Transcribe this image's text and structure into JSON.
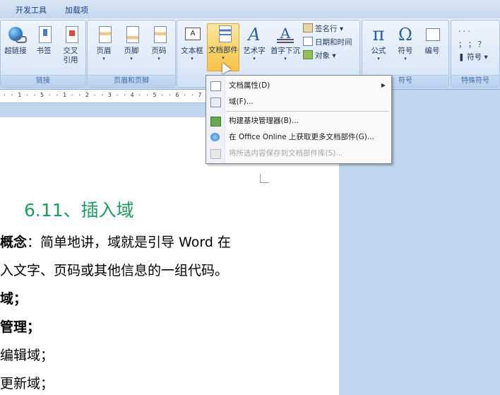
{
  "tabs": {
    "developer": "开发工具",
    "addins": "加载项"
  },
  "ribbon": {
    "links_group": {
      "label": "链接",
      "hyperlink": "超链接",
      "bookmark": "书签",
      "cross_ref_line1": "交叉",
      "cross_ref_line2": "引用"
    },
    "header_footer_group": {
      "label": "页眉和页脚",
      "header": "页眉",
      "footer": "页脚",
      "page_number": "页码"
    },
    "text_group": {
      "textbox": "文本框",
      "quick_parts": "文档部件",
      "wordart": "艺术字",
      "dropcap": "首字下沉",
      "signature_line": "签名行",
      "date_time": "日期和时间",
      "object": "对象"
    },
    "symbols_group": {
      "label": "符号",
      "equation": "公式",
      "symbol": "符号",
      "numbering": "编号"
    },
    "special_group": {
      "label": "特殊符号",
      "dots_row1": "·  ·  ·",
      "dots_row2": "；  ；  ？",
      "symbol_dropdown": "符号"
    }
  },
  "ruler": {
    "ticks": "· · 1 · · 5 · · 1 · · 2 · · 3 · · 4 · · 5 · · 6 · · 7 · · 8 · · 9 · 10 · 11 · 12"
  },
  "menu": {
    "items": [
      {
        "label": "文档属性(D)",
        "submenu": true
      },
      {
        "label": "域(F)..."
      },
      {
        "label": "构建基块管理器(B)..."
      },
      {
        "label": "在 Office Online 上获取更多文档部件(G)..."
      },
      {
        "label": "将所选内容保存到文档部件库(S)...",
        "disabled": true
      }
    ]
  },
  "document": {
    "heading": "6.11、插入域",
    "lines": [
      "概念：简单地讲，域就是引导 Word 在",
      "入文字、页码或其他信息的一组代码。",
      "域；",
      "管理；",
      "编辑域；",
      "更新域；"
    ]
  },
  "colors": {
    "heading": "#1a9e5d",
    "ribbon_bg": "#dde9f8",
    "active_button": "#fbd46a"
  }
}
